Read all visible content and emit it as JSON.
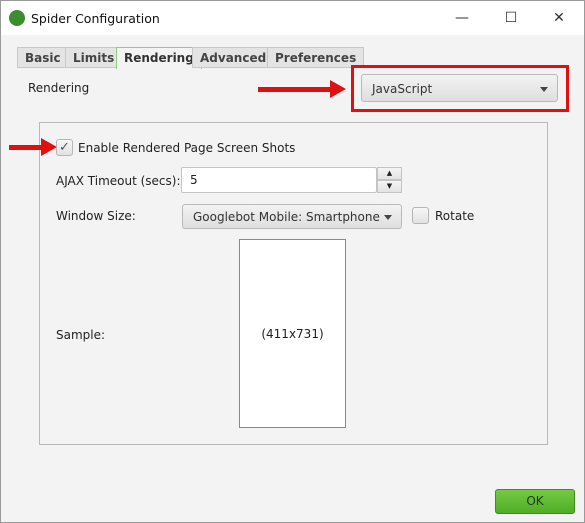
{
  "window": {
    "title": "Spider Configuration",
    "minimize": "—",
    "maximize": "☐",
    "close": "✕"
  },
  "tabs": [
    {
      "label": "Basic"
    },
    {
      "label": "Limits"
    },
    {
      "label": "Rendering",
      "active": true
    },
    {
      "label": "Advanced"
    },
    {
      "label": "Preferences"
    }
  ],
  "rendering": {
    "label": "Rendering",
    "selected": "JavaScript"
  },
  "screenshots": {
    "enable_label": "Enable Rendered Page Screen Shots",
    "enabled": true,
    "check": "✓",
    "ajax_label": "AJAX Timeout (secs):",
    "ajax_value": "5",
    "window_size_label": "Window Size:",
    "window_size_value": "Googlebot Mobile: Smartphone",
    "rotate_label": "Rotate",
    "rotate": false,
    "sample_label": "Sample:",
    "sample_size": "(411x731)"
  },
  "ok_label": "OK",
  "colors": {
    "annotation": "#e01010",
    "ok_button": "#5cb82e"
  }
}
